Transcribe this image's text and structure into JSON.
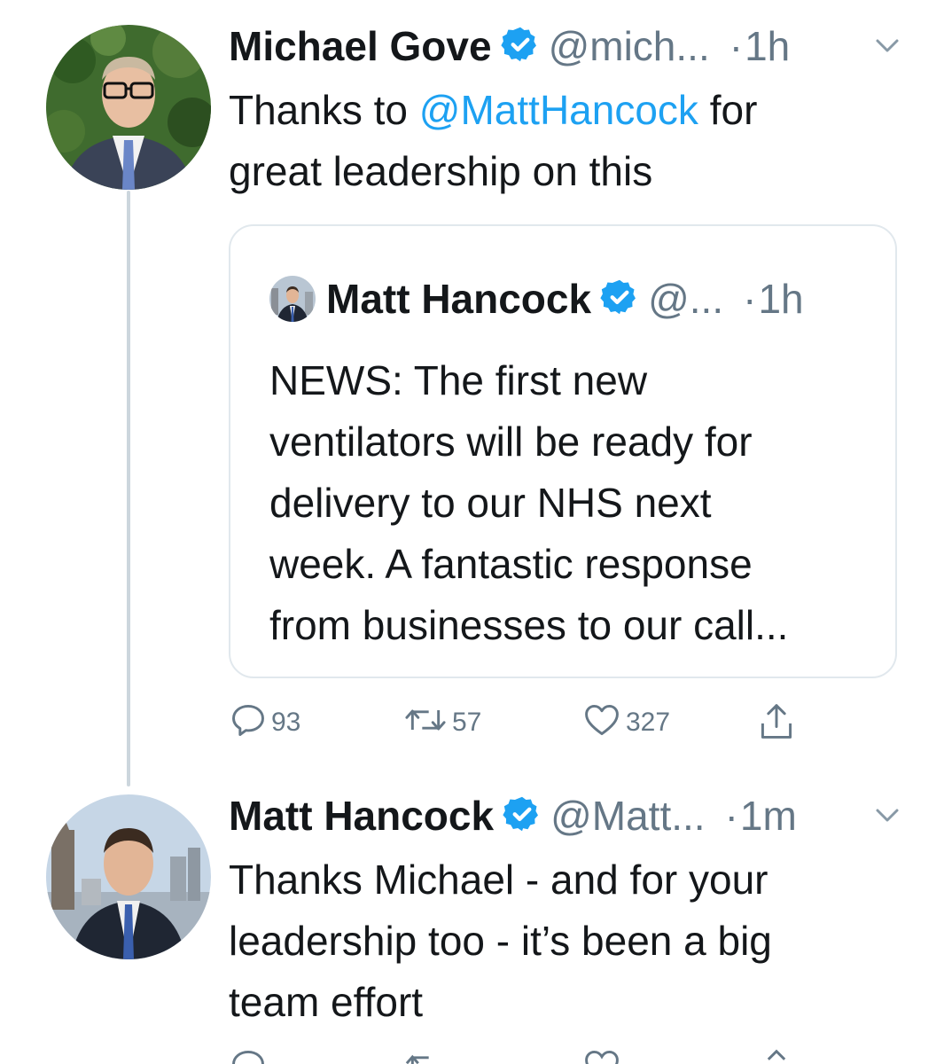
{
  "tweets": [
    {
      "display_name": "Michael Gove",
      "handle": "@mich...",
      "separator": "·",
      "timestamp": "1h",
      "text_before": "Thanks to ",
      "mention": "@MattHancock",
      "text_after": " for\ngreat leadership on this",
      "quoted_tweet": {
        "display_name": "Matt Hancock",
        "handle": "@...",
        "separator": "·",
        "timestamp": "1h",
        "text": "NEWS: The first new\nventilators will be ready for\ndelivery to our NHS next\nweek. A fantastic response\nfrom businesses to our call..."
      },
      "actions": {
        "replies": "93",
        "retweets": "57",
        "likes": "327"
      }
    },
    {
      "display_name": "Matt Hancock",
      "handle": "@Matt...",
      "separator": "·",
      "timestamp": "1m",
      "text": "Thanks Michael - and for your\nleadership too - it’s been a big\nteam effort"
    }
  ],
  "colors": {
    "link": "#1da1f2",
    "verified": "#1da1f2",
    "secondary_text": "#657786",
    "primary_text": "#14171a",
    "border": "#e1e8ed",
    "thread_line": "#ccd6dd"
  },
  "icons": {
    "verified": "verified-badge-icon",
    "caret": "chevron-down-icon",
    "reply": "reply-bubble-icon",
    "retweet": "retweet-arrows-icon",
    "like": "heart-icon",
    "share": "share-upload-icon"
  }
}
